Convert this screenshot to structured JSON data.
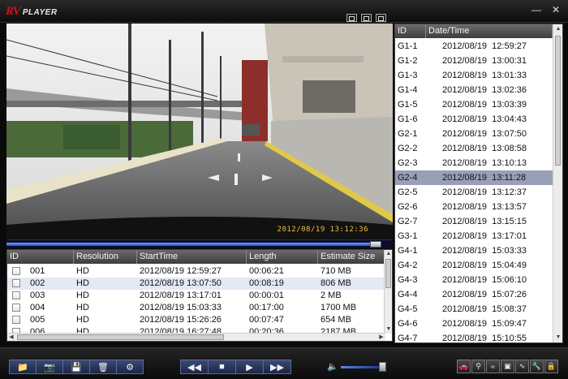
{
  "app": {
    "logo_rv": "RV",
    "logo_player": "PLAYER",
    "icons": {
      "minimize": "minimize-icon",
      "close": "close-icon"
    }
  },
  "view_modes": [
    "single-view-icon",
    "dual-view-icon",
    "quad-view-icon"
  ],
  "video": {
    "osd_datetime": "2012/08/19   13:12:36",
    "progress": 0.97
  },
  "file_list": {
    "columns": [
      "ID",
      "Resolution",
      "StartTime",
      "Length",
      "Estimate Size"
    ],
    "rows": [
      {
        "id": "001",
        "resolution": "HD",
        "start": "2012/08/19 12:59:27",
        "length": "00:06:21",
        "size": "710 MB",
        "selected": false
      },
      {
        "id": "002",
        "resolution": "HD",
        "start": "2012/08/19 13:07:50",
        "length": "00:08:19",
        "size": "806 MB",
        "selected": true
      },
      {
        "id": "003",
        "resolution": "HD",
        "start": "2012/08/19 13:17:01",
        "length": "00:00:01",
        "size": "2 MB",
        "selected": false
      },
      {
        "id": "004",
        "resolution": "HD",
        "start": "2012/08/19 15:03:33",
        "length": "00:17:00",
        "size": "1700 MB",
        "selected": false
      },
      {
        "id": "005",
        "resolution": "HD",
        "start": "2012/08/19 15:26:26",
        "length": "00:07:47",
        "size": "654 MB",
        "selected": false
      },
      {
        "id": "006",
        "resolution": "HD",
        "start": "2012/08/19 16:27:48",
        "length": "00:20:36",
        "size": "2187 MB",
        "selected": false
      }
    ]
  },
  "event_list": {
    "columns": [
      "ID",
      "Date/Time"
    ],
    "rows": [
      {
        "id": "G1-1",
        "datetime": "2012/08/19  12:59:27"
      },
      {
        "id": "G1-2",
        "datetime": "2012/08/19  13:00:31"
      },
      {
        "id": "G1-3",
        "datetime": "2012/08/19  13:01:33"
      },
      {
        "id": "G1-4",
        "datetime": "2012/08/19  13:02:36"
      },
      {
        "id": "G1-5",
        "datetime": "2012/08/19  13:03:39"
      },
      {
        "id": "G1-6",
        "datetime": "2012/08/19  13:04:43"
      },
      {
        "id": "G2-1",
        "datetime": "2012/08/19  13:07:50"
      },
      {
        "id": "G2-2",
        "datetime": "2012/08/19  13:08:58"
      },
      {
        "id": "G2-3",
        "datetime": "2012/08/19  13:10:13"
      },
      {
        "id": "G2-4",
        "datetime": "2012/08/19  13:11:28",
        "selected": true
      },
      {
        "id": "G2-5",
        "datetime": "2012/08/19  13:12:37"
      },
      {
        "id": "G2-6",
        "datetime": "2012/08/19  13:13:57"
      },
      {
        "id": "G2-7",
        "datetime": "2012/08/19  13:15:15"
      },
      {
        "id": "G3-1",
        "datetime": "2012/08/19  13:17:01"
      },
      {
        "id": "G4-1",
        "datetime": "2012/08/19  15:03:33"
      },
      {
        "id": "G4-2",
        "datetime": "2012/08/19  15:04:49"
      },
      {
        "id": "G4-3",
        "datetime": "2012/08/19  15:06:10"
      },
      {
        "id": "G4-4",
        "datetime": "2012/08/19  15:07:26"
      },
      {
        "id": "G4-5",
        "datetime": "2012/08/19  15:08:37"
      },
      {
        "id": "G4-6",
        "datetime": "2012/08/19  15:09:47"
      },
      {
        "id": "G4-7",
        "datetime": "2012/08/19  15:10:55"
      }
    ]
  },
  "toolbar": {
    "left_buttons": [
      "open-folder-icon",
      "snapshot-camera-icon",
      "save-disk-icon",
      "delete-trash-icon",
      "settings-gear-icon"
    ],
    "playback_buttons": [
      "rewind-icon",
      "stop-icon",
      "play-icon",
      "fast-forward-icon"
    ],
    "volume": 0.9,
    "right_tools": [
      "car-icon",
      "gps-icon",
      "speed-icon",
      "map-icon",
      "graph-icon",
      "tools-icon",
      "lock-icon"
    ]
  }
}
